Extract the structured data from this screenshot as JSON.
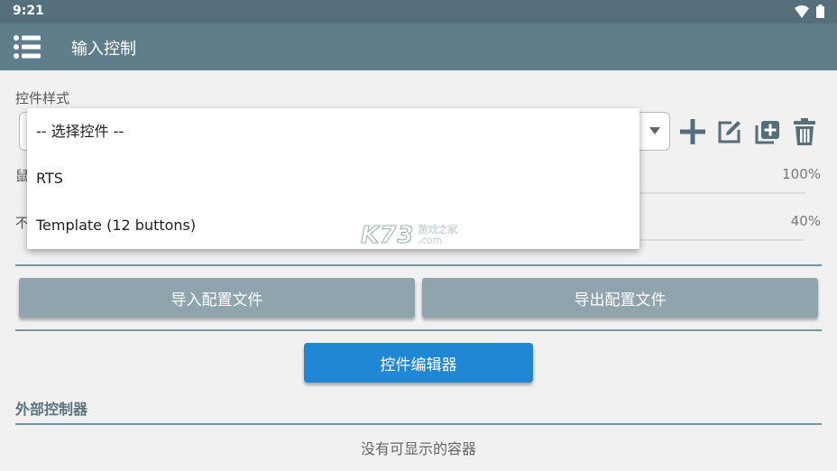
{
  "status_bar": {
    "time": "9:21"
  },
  "app_bar": {
    "title": "输入控制"
  },
  "control_style": {
    "label": "控件样式",
    "dropdown_options": [
      "-- 选择控件 --",
      "RTS",
      "Template (12 buttons)"
    ]
  },
  "sliders": [
    {
      "label": "鼠",
      "value_text": "100%",
      "value": 100
    },
    {
      "label": "不",
      "value_text": "40%",
      "value": 40
    }
  ],
  "buttons": {
    "import": "导入配置文件",
    "export": "导出配置文件",
    "editor": "控件编辑器"
  },
  "external_controllers": {
    "title": "外部控制器",
    "empty_text": "没有可显示的容器"
  },
  "watermark": {
    "logo": "K73",
    "line1": "游戏之家",
    "line2": ".com"
  },
  "colors": {
    "status_bar": "#556f7c",
    "app_bar": "#607d8b",
    "gray_button": "#90a4ae",
    "blue_button": "#1f87d4"
  }
}
